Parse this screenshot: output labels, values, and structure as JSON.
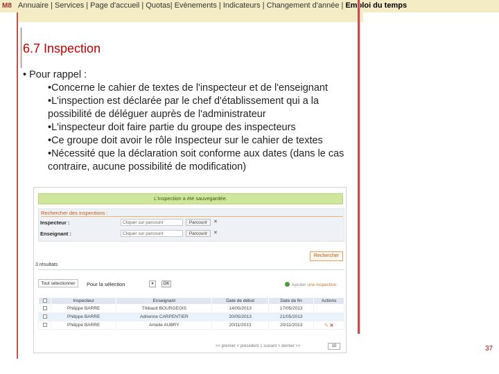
{
  "topbar": {
    "logo": "M8",
    "menu_items": [
      "Annuaire |",
      "Services | Page d'accueil | Quotas| Evènements | Indicateurs |",
      "Changement d'année |"
    ],
    "selected": "Emploi du temps"
  },
  "slide": {
    "title": "6.7 Inspection",
    "bullet1": "• Pour rappel :",
    "sub1": "•Concerne le cahier de textes de l'inspecteur et de l'enseignant",
    "sub2": "•L'inspection est déclarée par le chef d'établissement qui a la possibilité de déléguer auprès de l'administrateur",
    "sub3": "•L'inspecteur doit faire partie du groupe des inspecteurs",
    "sub4": "•Ce groupe doit avoir le rôle Inspecteur sur le cahier de textes",
    "sub5": "•Nécessité que la déclaration soit conforme aux dates (dans le cas contraire, aucune possibilité de modification)",
    "page_number": "37"
  },
  "screenshot": {
    "banner": "L'inspection a été sauvegardée.",
    "search_title": "Rechercher des inspections :",
    "inspecteur_label": "Inspecteur :",
    "enseignant_label": "Enseignant :",
    "input_placeholder": "Cliquer sur parcourir",
    "browse_label": "Parcourir",
    "clear_label": "✕",
    "search_button": "Rechercher",
    "results": "3 résultats",
    "tools_button": "Tout sélectionner",
    "for_selection": "Pour la sélection",
    "ok_label": "OK",
    "add_prefix": "Ajouter",
    "add_link": "une inspection",
    "columns": [
      "",
      "Inspecteur",
      "Enseignant",
      "Date de début",
      "Date de fin",
      "Actions"
    ],
    "rows": [
      {
        "inspecteur": "Philippe BARRE",
        "enseignant": "Thibault BOURGEOIS",
        "debut": "14/05/2013",
        "fin": "17/05/2013"
      },
      {
        "inspecteur": "Philippe BARRE",
        "enseignant": "Adrienne CARPENTIER",
        "debut": "20/05/2013",
        "fin": "21/05/2013"
      },
      {
        "inspecteur": "Philippe BARRE",
        "enseignant": "Amelie AUBRY",
        "debut": "20/11/2013",
        "fin": "20/11/2013"
      }
    ],
    "pager": "<< premier  < précédent    1    suivant >  dernier >>",
    "page_size": "10"
  },
  "colors": {
    "accent_red": "#c00000",
    "menu_bg": "#f4ecc4",
    "banner_green": "#cfe69c",
    "orange": "#c55a11"
  }
}
